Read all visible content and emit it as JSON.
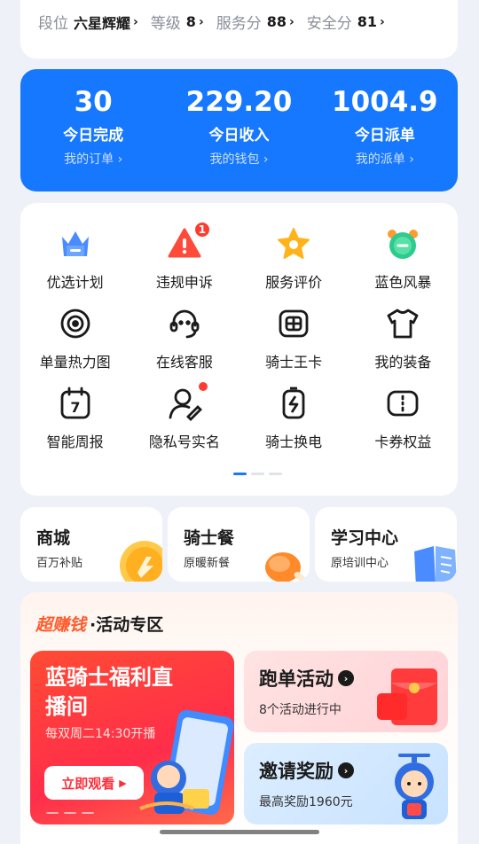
{
  "rank_strip": {
    "items": [
      {
        "label": "段位",
        "value": "六星辉耀"
      },
      {
        "label": "等级",
        "value": "8"
      },
      {
        "label": "服务分",
        "value": "88"
      },
      {
        "label": "安全分",
        "value": "81"
      }
    ]
  },
  "stats": [
    {
      "value": "30",
      "label": "今日完成",
      "link": "我的订单 ›"
    },
    {
      "value": "229.20",
      "label": "今日收入",
      "link": "我的钱包 ›"
    },
    {
      "value": "1004.9",
      "label": "今日派单",
      "link": "我的派单 ›"
    }
  ],
  "grid": [
    {
      "label": "优选计划",
      "icon": "crown-icon"
    },
    {
      "label": "违规申诉",
      "icon": "warning-icon",
      "badge": "1"
    },
    {
      "label": "服务评价",
      "icon": "star-icon"
    },
    {
      "label": "蓝色风暴",
      "icon": "alarm-clock-icon"
    },
    {
      "label": "单量热力图",
      "icon": "target-icon"
    },
    {
      "label": "在线客服",
      "icon": "headset-icon"
    },
    {
      "label": "骑士王卡",
      "icon": "sim-card-icon"
    },
    {
      "label": "我的装备",
      "icon": "tshirt-icon"
    },
    {
      "label": "智能周报",
      "icon": "calendar-icon",
      "calendar_day": "7"
    },
    {
      "label": "隐私号实名",
      "icon": "user-edit-icon"
    },
    {
      "label": "骑士换电",
      "icon": "battery-swap-icon"
    },
    {
      "label": "卡券权益",
      "icon": "ticket-icon"
    }
  ],
  "shortcuts": [
    {
      "title": "商城",
      "subtitle": "百万补贴"
    },
    {
      "title": "骑士餐",
      "subtitle": "原暖新餐"
    },
    {
      "title": "学习中心",
      "subtitle": "原培训中心"
    }
  ],
  "activity": {
    "brand": "超赚钱",
    "title": "·活动专区",
    "live": {
      "title": "蓝骑士福利直播间",
      "schedule": "每双周二14:30开播",
      "button": "立即观看"
    },
    "promos": [
      {
        "title": "跑单活动",
        "subtitle": "8个活动进行中"
      },
      {
        "title": "邀请奖励",
        "subtitle": "最高奖励1960元"
      }
    ]
  },
  "colors": {
    "accent": "#1677ff",
    "alert": "#ff3b30",
    "brand_orange": "#ff5a2a"
  }
}
